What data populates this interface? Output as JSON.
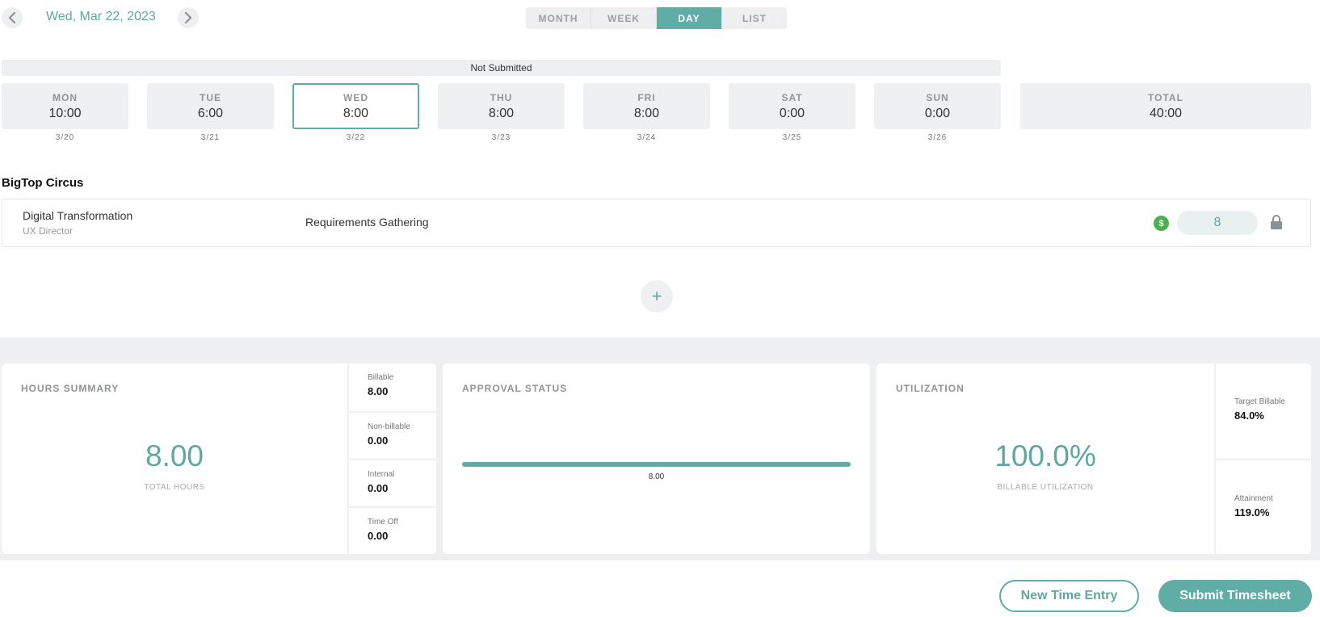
{
  "header": {
    "date_label": "Wed, Mar 22, 2023",
    "prev_icon": "chevron-left-icon",
    "next_icon": "chevron-right-icon",
    "view_tabs": [
      {
        "label": "MONTH",
        "active": false
      },
      {
        "label": "WEEK",
        "active": false
      },
      {
        "label": "DAY",
        "active": true
      },
      {
        "label": "LIST",
        "active": false
      }
    ]
  },
  "timesheet": {
    "status": "Not Submitted",
    "days": [
      {
        "name": "MON",
        "hours": "10:00",
        "date": "3/20",
        "selected": false
      },
      {
        "name": "TUE",
        "hours": "6:00",
        "date": "3/21",
        "selected": false
      },
      {
        "name": "WED",
        "hours": "8:00",
        "date": "3/22",
        "selected": true
      },
      {
        "name": "THU",
        "hours": "8:00",
        "date": "3/23",
        "selected": false
      },
      {
        "name": "FRI",
        "hours": "8:00",
        "date": "3/24",
        "selected": false
      },
      {
        "name": "SAT",
        "hours": "0:00",
        "date": "3/25",
        "selected": false
      },
      {
        "name": "SUN",
        "hours": "0:00",
        "date": "3/26",
        "selected": false
      }
    ],
    "total": {
      "label": "TOTAL",
      "hours": "40:00"
    }
  },
  "entries": {
    "client": "BigTop Circus",
    "rows": [
      {
        "project": "Digital Transformation",
        "role": "UX Director",
        "task": "Requirements Gathering",
        "billable_symbol": "$",
        "hours": "8",
        "lock_icon": "lock-icon"
      }
    ],
    "add_icon": "plus-icon",
    "add_symbol": "+"
  },
  "hours_summary": {
    "title": "HOURS SUMMARY",
    "total": "8.00",
    "total_caption": "TOTAL HOURS",
    "breakdown": [
      {
        "label": "Billable",
        "value": "8.00"
      },
      {
        "label": "Non-billable",
        "value": "0.00"
      },
      {
        "label": "Internal",
        "value": "0.00"
      },
      {
        "label": "Time Off",
        "value": "0.00"
      }
    ]
  },
  "approval_status": {
    "title": "APPROVAL STATUS",
    "bar_value": "8.00",
    "bar_fraction": 1.0,
    "bar_color": "#5fada4"
  },
  "utilization": {
    "title": "UTILIZATION",
    "value": "100.0%",
    "caption": "BILLABLE UTILIZATION",
    "target_label": "Target Billable",
    "target_value": "84.0%",
    "attainment_label": "Attainment",
    "attainment_value": "119.0%"
  },
  "actions": {
    "new_entry_label": "New Time Entry",
    "submit_label": "Submit Timesheet"
  },
  "colors": {
    "accent": "#5fada4",
    "billable_green": "#4caf50"
  }
}
